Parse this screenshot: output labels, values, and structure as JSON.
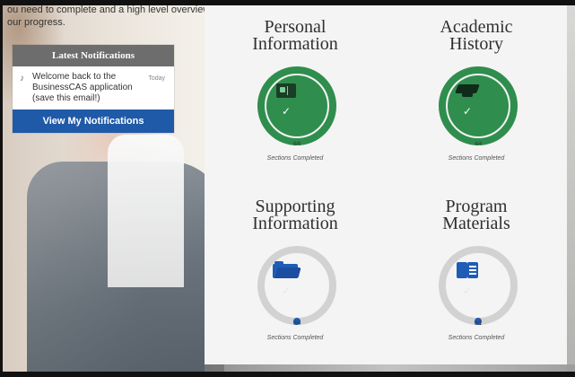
{
  "intro": {
    "line1": "ou need to complete and a high level overview of",
    "line2": "our progress."
  },
  "notifications": {
    "header": "Latest Notifications",
    "item_message": "Welcome back to the BusinessCAS application (save this email!)",
    "item_when": "Today",
    "button_label": "View My Notifications"
  },
  "cards": [
    {
      "title_line1": "Personal",
      "title_line2": "Information",
      "count": "6/6",
      "status": "Sections Completed",
      "progress": 1.0,
      "icon": "id-card-icon",
      "accent": "#2f8e4d"
    },
    {
      "title_line1": "Academic",
      "title_line2": "History",
      "count": "4/4",
      "status": "Sections Completed",
      "progress": 1.0,
      "icon": "graduation-cap-icon",
      "accent": "#2f8e4d"
    },
    {
      "title_line1": "Supporting",
      "title_line2": "Information",
      "count": "0/4",
      "status": "Sections Completed",
      "progress": 0.0,
      "icon": "folder-icon",
      "accent": "#1e5cb5"
    },
    {
      "title_line1": "Program",
      "title_line2": "Materials",
      "count": "0/1",
      "status": "Sections Completed",
      "progress": 0.0,
      "icon": "book-icon",
      "accent": "#1e5cb5"
    }
  ]
}
